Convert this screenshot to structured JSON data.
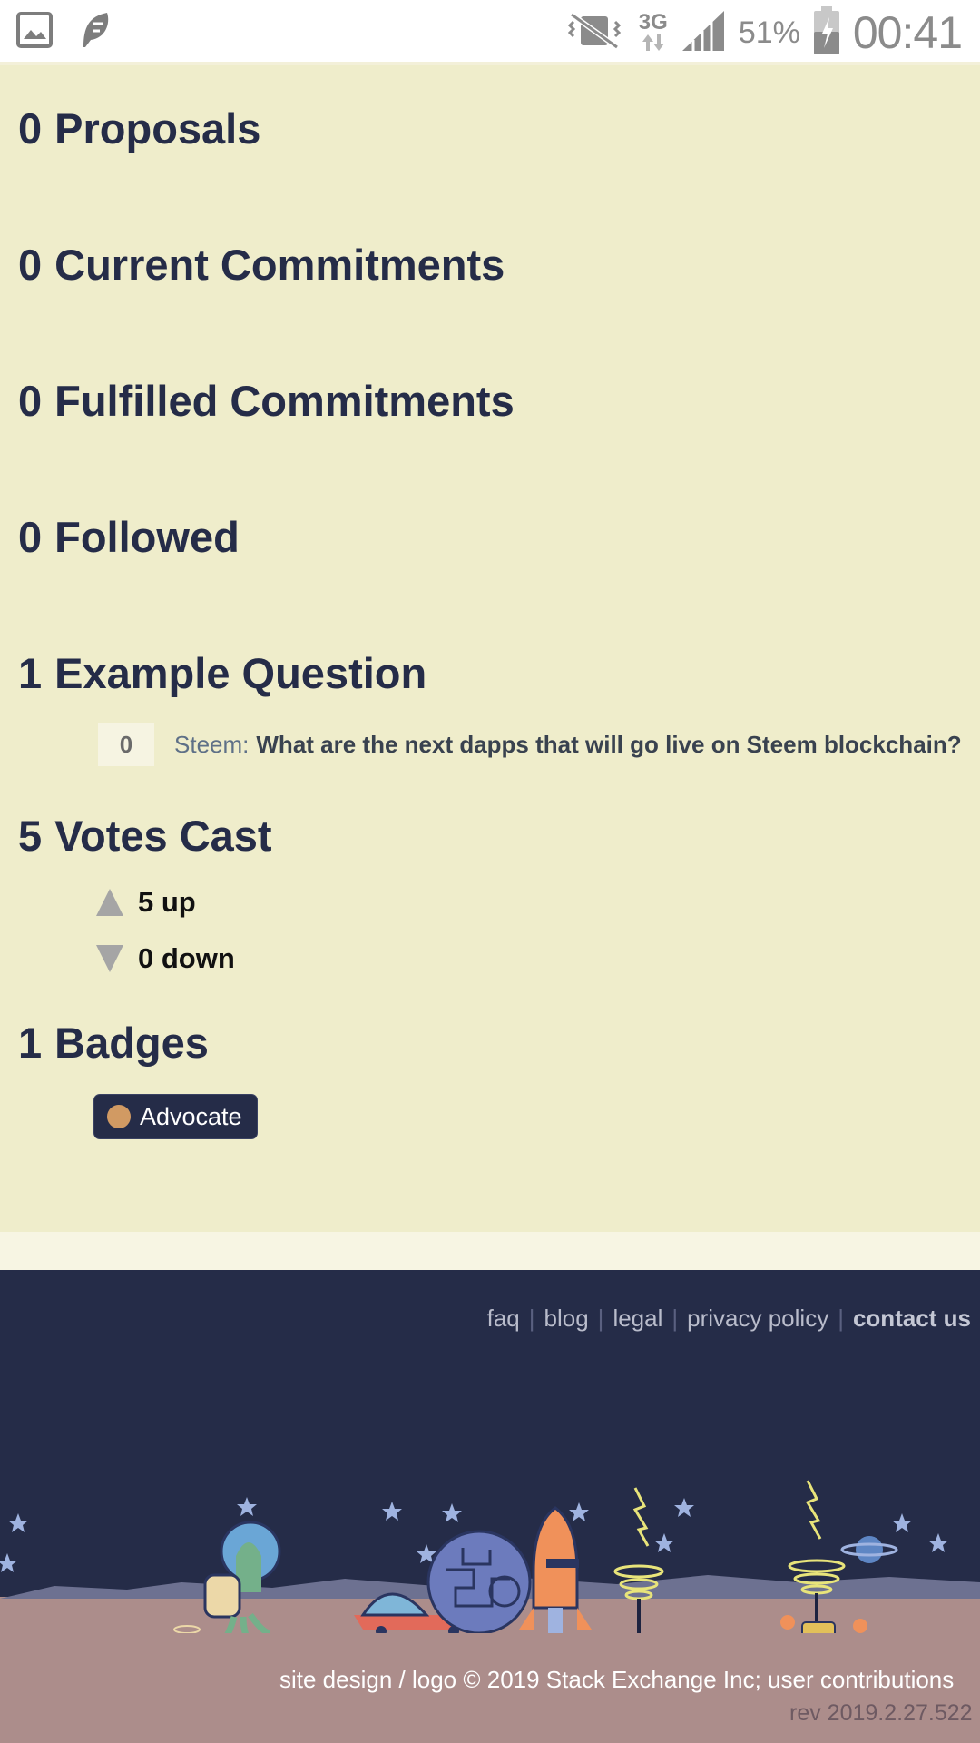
{
  "status_bar": {
    "icons_left": [
      "gallery-icon",
      "app-leaf-icon"
    ],
    "icons_right": [
      "vibrate-off-icon",
      "network-3g-icon",
      "signal-icon",
      "battery-icon"
    ],
    "network": "3G",
    "battery_percent": "51%",
    "time": "00:41"
  },
  "sections": {
    "proposals": {
      "count": "0",
      "label": "Proposals"
    },
    "current_commitments": {
      "count": "0",
      "label": "Current Commitments"
    },
    "fulfilled_commitments": {
      "count": "0",
      "label": "Fulfilled Commitments"
    },
    "followed": {
      "count": "0",
      "label": "Followed"
    },
    "example_question": {
      "count": "1",
      "label": "Example Question"
    },
    "votes_cast": {
      "count": "5",
      "label": "Votes Cast"
    },
    "badges": {
      "count": "1",
      "label": "Badges"
    }
  },
  "question": {
    "votes": "0",
    "site": "Steem",
    "colon": ":",
    "title": "What are the next dapps that will go live on Steem blockchain?"
  },
  "votes": {
    "up": "5 up",
    "down": "0 down"
  },
  "badge": {
    "name": "Advocate",
    "color": "#d19a63"
  },
  "footer": {
    "links": [
      "faq",
      "blog",
      "legal",
      "privacy policy"
    ],
    "contact": "contact us",
    "copyright": "site design / logo © 2019 Stack Exchange Inc; user contributions",
    "rev": "rev 2019.2.27.522"
  },
  "colors": {
    "page_bg": "#efedcb",
    "text": "#252c48",
    "footer_bg": "#252c48",
    "ground": "#ac8d8b"
  }
}
